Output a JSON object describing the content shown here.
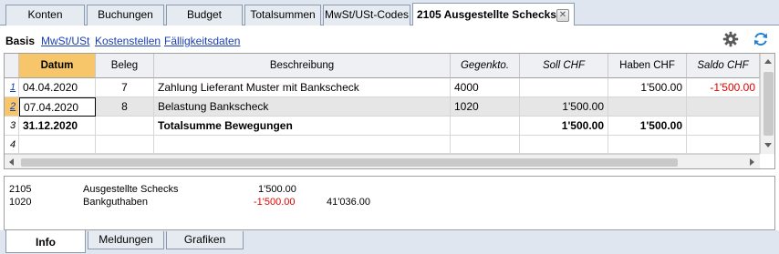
{
  "tabs": [
    {
      "label": "Konten"
    },
    {
      "label": "Buchungen"
    },
    {
      "label": "Budget"
    },
    {
      "label": "Totalsummen"
    },
    {
      "label": "MwSt/USt-Codes"
    },
    {
      "label": "2105 Ausgestellte Schecks"
    }
  ],
  "tab_close_symbol": "✕",
  "views": [
    "Basis",
    "MwSt/USt",
    "Kostenstellen",
    "Fälligkeitsdaten"
  ],
  "toolbar_icons": [
    "gear-icon",
    "refresh-icon"
  ],
  "table": {
    "headers": [
      "Datum",
      "Beleg",
      "Beschreibung",
      "Gegenkto.",
      "Soll CHF",
      "Haben CHF",
      "Saldo CHF"
    ],
    "rows": [
      {
        "num": "1",
        "datum": "04.04.2020",
        "beleg": "7",
        "beschreibung": "Zahlung Lieferant Muster mit Bankscheck",
        "gegenkto": "4000",
        "soll": "",
        "haben": "1'500.00",
        "saldo": "-1'500.00"
      },
      {
        "num": "2",
        "datum": "07.04.2020",
        "beleg": "8",
        "beschreibung": "Belastung Bankscheck",
        "gegenkto": "1020",
        "soll": "1'500.00",
        "haben": "",
        "saldo": ""
      },
      {
        "num": "3",
        "datum": "31.12.2020",
        "beleg": "",
        "beschreibung": "Totalsumme Bewegungen",
        "gegenkto": "",
        "soll": "1'500.00",
        "haben": "1'500.00",
        "saldo": ""
      },
      {
        "num": "4",
        "datum": "",
        "beleg": "",
        "beschreibung": "",
        "gegenkto": "",
        "soll": "",
        "haben": "",
        "saldo": ""
      }
    ]
  },
  "info": [
    {
      "account": "2105",
      "name": "Ausgestellte Schecks",
      "amount": "1'500.00",
      "balance": ""
    },
    {
      "account": "1020",
      "name": "Bankguthaben",
      "amount": "-1'500.00",
      "balance": "41'036.00"
    }
  ],
  "bottom_tabs": [
    "Info",
    "Meldungen",
    "Grafiken"
  ],
  "colors": {
    "accent": "#f7c66a",
    "link": "#1a3fb5",
    "negative": "#e00000",
    "tabbar": "#dfe6ef"
  }
}
